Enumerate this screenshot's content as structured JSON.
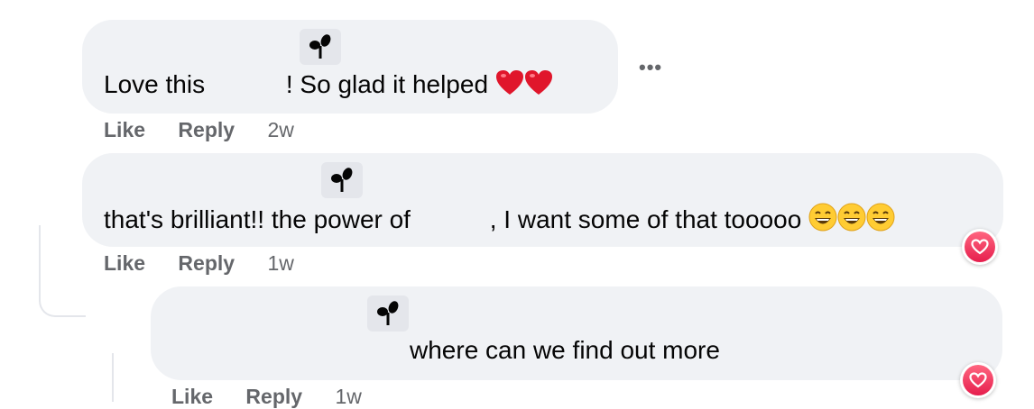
{
  "comments": [
    {
      "text_before": "Love this",
      "text_after": "! So glad it helped",
      "actions": {
        "like": "Like",
        "reply": "Reply",
        "time": "2w"
      }
    },
    {
      "text_before": "that's brilliant!! the power of",
      "text_after": ", I want some of that tooooo",
      "actions": {
        "like": "Like",
        "reply": "Reply",
        "time": "1w"
      }
    },
    {
      "text_before": "where can we find out more",
      "actions": {
        "like": "Like",
        "reply": "Reply",
        "time": "1w"
      }
    }
  ],
  "more_label": "•••",
  "icons": {
    "badge": "sprout-icon",
    "emoji_heart": "red-heart-icon",
    "emoji_grin": "grinning-face-icon",
    "reaction": "love-reaction-icon",
    "more": "more-options-icon"
  },
  "colors": {
    "bubble": "#f0f2f5",
    "meta_text": "#65676b",
    "love_reaction": "#f33e58"
  }
}
